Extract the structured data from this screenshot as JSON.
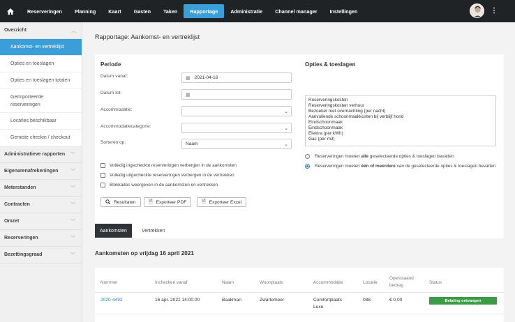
{
  "nav": {
    "items": [
      "Reserveringen",
      "Planning",
      "Kaart",
      "Gasten",
      "Taken",
      "Rapportage",
      "Administratie",
      "Channel manager",
      "Instellingen"
    ],
    "active": "Rapportage"
  },
  "sidebar": {
    "header": "Overzicht",
    "items": [
      "Aankomst- en vertreklijst",
      "Opties en toeslagen",
      "Opties en toeslagen totalen",
      "Geïmporteerde reserveringen",
      "Locaties beschikbaar",
      "Gemiste checkin / checkout"
    ],
    "groups": [
      "Administratieve rapporten",
      "Eigenarenafrekeningen",
      "Meterstanden",
      "Contracten",
      "Omzet",
      "Reserveringen",
      "Bezettingsgraad"
    ]
  },
  "page": {
    "title": "Rapportage: Aankomst- en vertreklijst"
  },
  "periode": {
    "title": "Periode",
    "labels": {
      "datum_vanaf": "Datum vanaf:",
      "datum_tot": "Datum tot:",
      "accommodatie": "Accommodatie:",
      "accommodatiecategorie": "Accommodatiecategorie:",
      "sorteren": "Sorteren op:"
    },
    "values": {
      "datum_vanaf": "2021-04-16",
      "datum_tot": "",
      "accommodatie": "",
      "accommodatiecategorie": "",
      "sorteren": "Naam"
    },
    "checks": [
      "Volledig ingecheckte reserveringen verbergen in de aankomsten",
      "Volledig uitgecheckte reserveringen verbergen in de vertrekken",
      "Blokkades weergeven in de aankomsten en vertrekken"
    ],
    "buttons": {
      "resultaten": "Resultaten",
      "pdf": "Exporteer PDF",
      "excel": "Exporteer Excel"
    }
  },
  "opties": {
    "title": "Opties & toeslagen",
    "list": [
      "Reserveringskosten",
      "Reserveringskosten verhuur",
      "Bezoeker met overnachting (per nacht)",
      "Aanvullende schoonmaakkosten bij verblijf hond",
      "Eindschoonmaak",
      "Eindschoonmaak",
      "Elektra (per kWh)",
      "Gas (per m3)"
    ],
    "radio1": {
      "pre": "Reserveringen moeten ",
      "bold": "alle",
      "post": " geselecteerde opties & toeslagen bevatten"
    },
    "radio2": {
      "pre": "Reserveringen moeten ",
      "bold": "één of meerdere",
      "post": " van de geselecteerde opties & toeslagen bevatten"
    }
  },
  "tabs": [
    "Aankomsten",
    "Vertrekken"
  ],
  "section": {
    "title": "Aankomsten op vrijdag 16 april 2021"
  },
  "table": {
    "headers": [
      "Nummer",
      "Inchecken vanaf",
      "Naam",
      "Woonplaats",
      "Accommodatie",
      "Locatie",
      "Openstaand bedrag",
      "Status"
    ],
    "rows": [
      {
        "nummer": "2020-4492",
        "inchecken": "16 apr. 2021 14:00:00",
        "naam": "Baakman",
        "woonplaats": "Zwartemeer",
        "accommodatie": "Comfortplaats Luxe",
        "locatie": "088",
        "bedrag": "€ 0,00",
        "status": "Betaling ontvangen"
      }
    ]
  },
  "colors": {
    "nav_bg": "#1f2326",
    "accent": "#3a9ed8",
    "success": "#3c9b46"
  }
}
